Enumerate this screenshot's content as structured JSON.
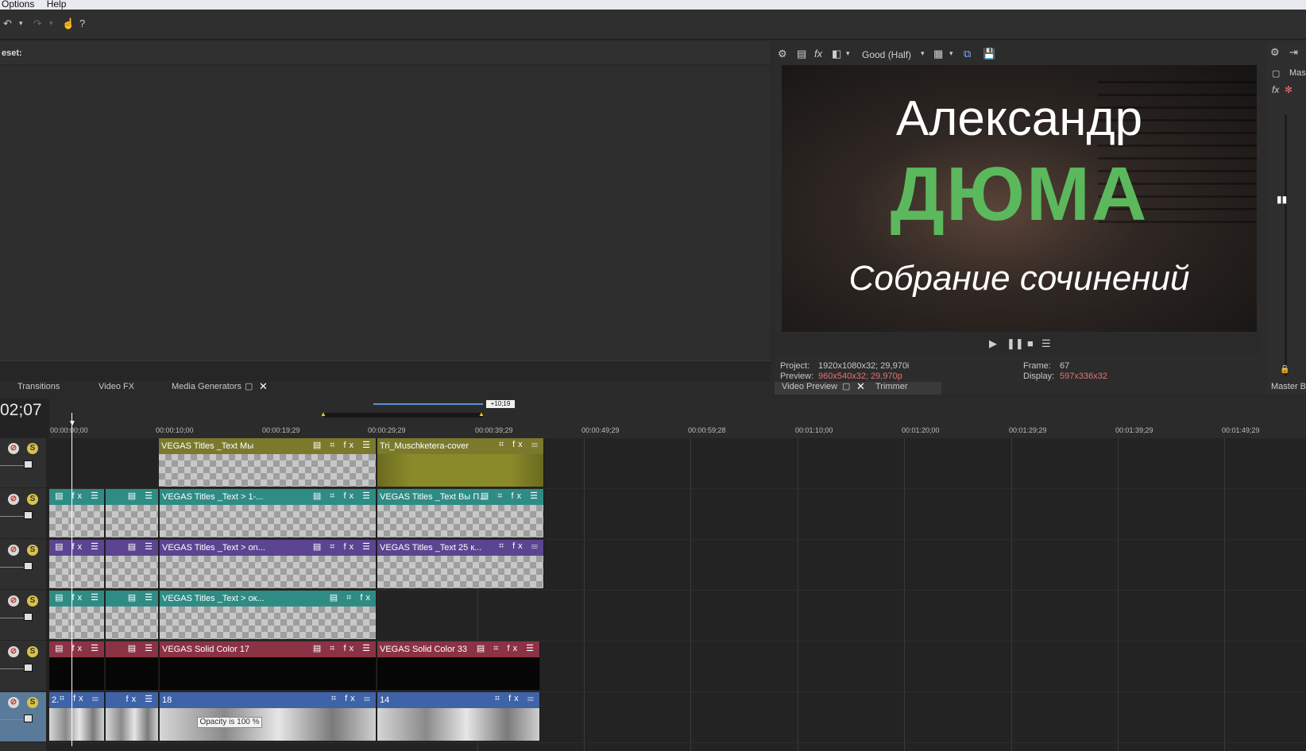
{
  "menubar": {
    "items": [
      "Options",
      "Help"
    ]
  },
  "toolbar": {
    "icons": [
      "undo-icon",
      "redo-icon",
      "help-icon"
    ]
  },
  "left_panel": {
    "header_label": "eset:"
  },
  "tabs": {
    "transitions": "Transitions",
    "video_fx": "Video FX",
    "media_generators": "Media Generators"
  },
  "preview": {
    "quality": "Good (Half)",
    "title_line1": "Александр",
    "title_line2": "ДЮМА",
    "title_line3": "Собрание сочинений",
    "project_label": "Project:",
    "project_value": "1920x1080x32; 29,970i",
    "preview_label": "Preview:",
    "preview_value": "960x540x32; 29,970p",
    "frame_label": "Frame:",
    "frame_value": "67",
    "display_label": "Display:",
    "display_value": "597x336x32",
    "tab_video_preview": "Video Preview",
    "tab_trimmer": "Trimmer"
  },
  "right_strip": {
    "master_label": "Mas",
    "master_bus_label": "Master B"
  },
  "timeline": {
    "time_display": "02;07",
    "loop_region_label": "+10;19",
    "ruler_ticks": [
      "00:00:00;00",
      "00:00:10;00",
      "00:00:19;29",
      "00:00:29;29",
      "00:00:39;29",
      "00:00:49;29",
      "00:00:59;28",
      "00:01:10;00",
      "00:01:20;00",
      "00:01:29;29",
      "00:01:39;29",
      "00:01:49;29"
    ],
    "tooltip": "Opacity is 100 %",
    "tracks": [
      {
        "clips": [
          {
            "label": "VEGAS Titles _Text Мы"
          },
          {
            "label": "Tri_Muschketera-cover"
          }
        ]
      },
      {
        "clips": [
          {
            "label": ""
          },
          {
            "label": ""
          },
          {
            "label": "VEGAS Titles _Text > 1-..."
          },
          {
            "label": "VEGAS Titles _Text Вы П..."
          }
        ]
      },
      {
        "clips": [
          {
            "label": ""
          },
          {
            "label": ""
          },
          {
            "label": "VEGAS Titles _Text > on..."
          },
          {
            "label": "VEGAS Titles _Text 25 к..."
          }
        ]
      },
      {
        "clips": [
          {
            "label": ""
          },
          {
            "label": ""
          },
          {
            "label": "VEGAS Titles _Text > ок..."
          }
        ]
      },
      {
        "clips": [
          {
            "label": ""
          },
          {
            "label": ""
          },
          {
            "label": "VEGAS Solid Color 17"
          },
          {
            "label": "VEGAS Solid Color 33"
          }
        ]
      },
      {
        "clips": [
          {
            "label": "2."
          },
          {
            "label": ""
          },
          {
            "label": "18"
          },
          {
            "label": "14"
          }
        ]
      }
    ]
  }
}
